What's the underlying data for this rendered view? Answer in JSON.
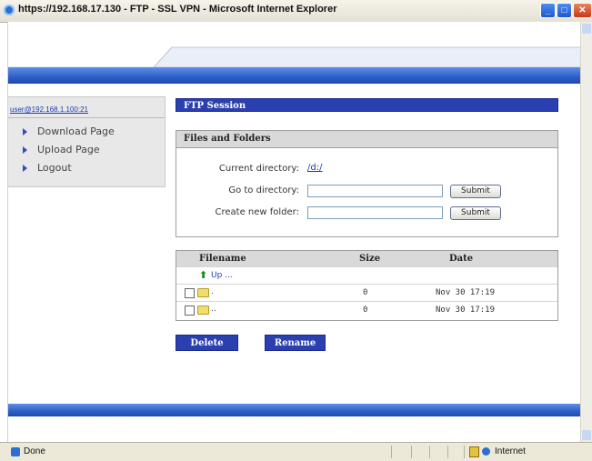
{
  "window": {
    "title": "https://192.168.17.130 - FTP - SSL VPN - Microsoft Internet Explorer"
  },
  "sidebar": {
    "user": "user@192.168.1.100:21",
    "items": [
      {
        "label": "Download Page"
      },
      {
        "label": "Upload Page"
      },
      {
        "label": "Logout"
      }
    ]
  },
  "session": {
    "title": "FTP Session"
  },
  "files_panel": {
    "title": "Files and Folders",
    "current_dir_label": "Current directory:",
    "current_dir_value": "/d:/",
    "goto_label": "Go to directory:",
    "goto_value": "",
    "newfolder_label": "Create new folder:",
    "newfolder_value": "",
    "submit_label": "Submit"
  },
  "file_table": {
    "headers": {
      "filename": "Filename",
      "size": "Size",
      "date": "Date"
    },
    "up_label": "Up ...",
    "rows": [
      {
        "name": ".",
        "size": "0",
        "date": "Nov 30 17:19"
      },
      {
        "name": "..",
        "size": "0",
        "date": "Nov 30 17:19"
      }
    ]
  },
  "actions": {
    "delete": "Delete",
    "rename": "Rename"
  },
  "statusbar": {
    "status": "Done",
    "zone": "Internet"
  },
  "colors": {
    "accent_blue": "#2a3fb0",
    "bar_blue": "#2d5fc7",
    "link": "#1a3bb5"
  }
}
